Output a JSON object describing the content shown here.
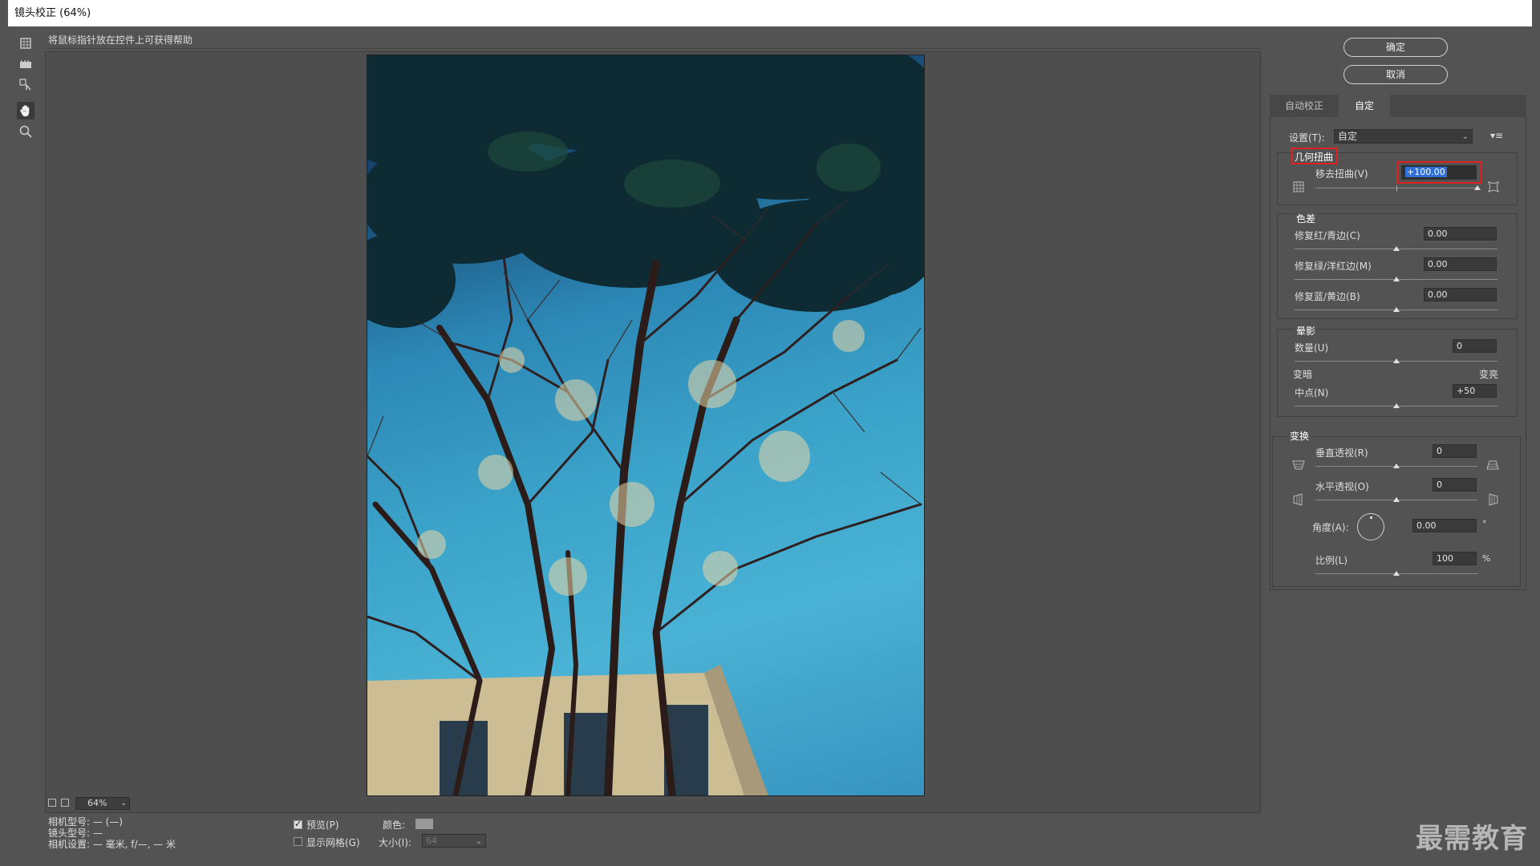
{
  "window": {
    "title": "镜头校正 (64%)"
  },
  "hint": "将鼠标指针放在控件上可获得帮助",
  "buttons": {
    "ok": "确定",
    "cancel": "取消"
  },
  "tabs": [
    "自动校正",
    "自定"
  ],
  "settings": {
    "label": "设置(T):",
    "value": "自定"
  },
  "geometric": {
    "title": "几何扭曲",
    "remove_distortion": {
      "label": "移去扭曲(V)",
      "value": "+100.00",
      "level": 1.0
    }
  },
  "chromatic": {
    "title": "色差",
    "rows": [
      {
        "label": "修复红/青边(C)",
        "value": "0.00",
        "level": 0.5
      },
      {
        "label": "修复绿/洋红边(M)",
        "value": "0.00",
        "level": 0.5
      },
      {
        "label": "修复蓝/黄边(B)",
        "value": "0.00",
        "level": 0.5
      }
    ]
  },
  "vignette": {
    "title": "晕影",
    "amount": {
      "label": "数量(U)",
      "value": "0",
      "level": 0.5
    },
    "darken": "变暗",
    "lighten": "变亮",
    "midpoint": {
      "label": "中点(N)",
      "value": "+50",
      "level": 0.5
    }
  },
  "transform": {
    "title": "变换",
    "vertical": {
      "label": "垂直透视(R)",
      "value": "0",
      "level": 0.5
    },
    "horizontal": {
      "label": "水平透视(O)",
      "value": "0",
      "level": 0.5
    },
    "angle": {
      "label": "角度(A):",
      "value": "0.00",
      "unit": "°"
    },
    "scale": {
      "label": "比例(L)",
      "value": "100",
      "unit": "%",
      "level": 0.5
    }
  },
  "zoom": {
    "value": "64%"
  },
  "camera_info": {
    "camera_model": "相机型号: — (—)",
    "lens_model": "镜头型号: —",
    "camera_settings": "相机设置: — 毫米, f/—, — 米"
  },
  "options": {
    "preview": "预览(P)",
    "show_grid": "显示网格(G)",
    "color_label": "颜色:",
    "size_label": "大小(I):",
    "size_value": "64"
  },
  "watermark": "最需教育"
}
